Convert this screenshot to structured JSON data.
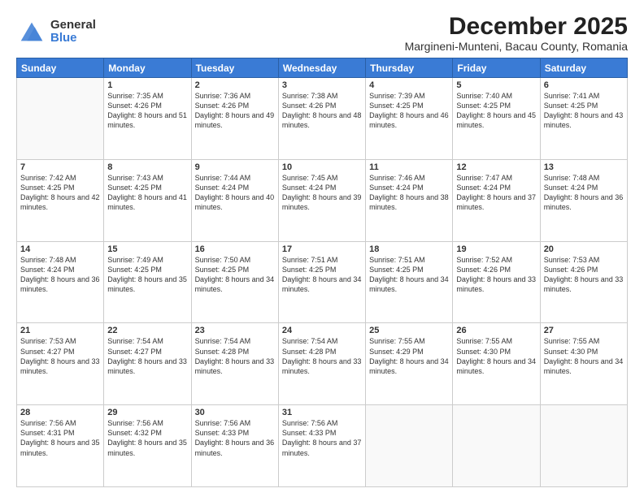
{
  "logo": {
    "general": "General",
    "blue": "Blue"
  },
  "title": "December 2025",
  "subtitle": "Margineni-Munteni, Bacau County, Romania",
  "weekdays": [
    "Sunday",
    "Monday",
    "Tuesday",
    "Wednesday",
    "Thursday",
    "Friday",
    "Saturday"
  ],
  "weeks": [
    [
      {
        "day": "",
        "sunrise": "",
        "sunset": "",
        "daylight": ""
      },
      {
        "day": "1",
        "sunrise": "Sunrise: 7:35 AM",
        "sunset": "Sunset: 4:26 PM",
        "daylight": "Daylight: 8 hours and 51 minutes."
      },
      {
        "day": "2",
        "sunrise": "Sunrise: 7:36 AM",
        "sunset": "Sunset: 4:26 PM",
        "daylight": "Daylight: 8 hours and 49 minutes."
      },
      {
        "day": "3",
        "sunrise": "Sunrise: 7:38 AM",
        "sunset": "Sunset: 4:26 PM",
        "daylight": "Daylight: 8 hours and 48 minutes."
      },
      {
        "day": "4",
        "sunrise": "Sunrise: 7:39 AM",
        "sunset": "Sunset: 4:25 PM",
        "daylight": "Daylight: 8 hours and 46 minutes."
      },
      {
        "day": "5",
        "sunrise": "Sunrise: 7:40 AM",
        "sunset": "Sunset: 4:25 PM",
        "daylight": "Daylight: 8 hours and 45 minutes."
      },
      {
        "day": "6",
        "sunrise": "Sunrise: 7:41 AM",
        "sunset": "Sunset: 4:25 PM",
        "daylight": "Daylight: 8 hours and 43 minutes."
      }
    ],
    [
      {
        "day": "7",
        "sunrise": "Sunrise: 7:42 AM",
        "sunset": "Sunset: 4:25 PM",
        "daylight": "Daylight: 8 hours and 42 minutes."
      },
      {
        "day": "8",
        "sunrise": "Sunrise: 7:43 AM",
        "sunset": "Sunset: 4:25 PM",
        "daylight": "Daylight: 8 hours and 41 minutes."
      },
      {
        "day": "9",
        "sunrise": "Sunrise: 7:44 AM",
        "sunset": "Sunset: 4:24 PM",
        "daylight": "Daylight: 8 hours and 40 minutes."
      },
      {
        "day": "10",
        "sunrise": "Sunrise: 7:45 AM",
        "sunset": "Sunset: 4:24 PM",
        "daylight": "Daylight: 8 hours and 39 minutes."
      },
      {
        "day": "11",
        "sunrise": "Sunrise: 7:46 AM",
        "sunset": "Sunset: 4:24 PM",
        "daylight": "Daylight: 8 hours and 38 minutes."
      },
      {
        "day": "12",
        "sunrise": "Sunrise: 7:47 AM",
        "sunset": "Sunset: 4:24 PM",
        "daylight": "Daylight: 8 hours and 37 minutes."
      },
      {
        "day": "13",
        "sunrise": "Sunrise: 7:48 AM",
        "sunset": "Sunset: 4:24 PM",
        "daylight": "Daylight: 8 hours and 36 minutes."
      }
    ],
    [
      {
        "day": "14",
        "sunrise": "Sunrise: 7:48 AM",
        "sunset": "Sunset: 4:24 PM",
        "daylight": "Daylight: 8 hours and 36 minutes."
      },
      {
        "day": "15",
        "sunrise": "Sunrise: 7:49 AM",
        "sunset": "Sunset: 4:25 PM",
        "daylight": "Daylight: 8 hours and 35 minutes."
      },
      {
        "day": "16",
        "sunrise": "Sunrise: 7:50 AM",
        "sunset": "Sunset: 4:25 PM",
        "daylight": "Daylight: 8 hours and 34 minutes."
      },
      {
        "day": "17",
        "sunrise": "Sunrise: 7:51 AM",
        "sunset": "Sunset: 4:25 PM",
        "daylight": "Daylight: 8 hours and 34 minutes."
      },
      {
        "day": "18",
        "sunrise": "Sunrise: 7:51 AM",
        "sunset": "Sunset: 4:25 PM",
        "daylight": "Daylight: 8 hours and 34 minutes."
      },
      {
        "day": "19",
        "sunrise": "Sunrise: 7:52 AM",
        "sunset": "Sunset: 4:26 PM",
        "daylight": "Daylight: 8 hours and 33 minutes."
      },
      {
        "day": "20",
        "sunrise": "Sunrise: 7:53 AM",
        "sunset": "Sunset: 4:26 PM",
        "daylight": "Daylight: 8 hours and 33 minutes."
      }
    ],
    [
      {
        "day": "21",
        "sunrise": "Sunrise: 7:53 AM",
        "sunset": "Sunset: 4:27 PM",
        "daylight": "Daylight: 8 hours and 33 minutes."
      },
      {
        "day": "22",
        "sunrise": "Sunrise: 7:54 AM",
        "sunset": "Sunset: 4:27 PM",
        "daylight": "Daylight: 8 hours and 33 minutes."
      },
      {
        "day": "23",
        "sunrise": "Sunrise: 7:54 AM",
        "sunset": "Sunset: 4:28 PM",
        "daylight": "Daylight: 8 hours and 33 minutes."
      },
      {
        "day": "24",
        "sunrise": "Sunrise: 7:54 AM",
        "sunset": "Sunset: 4:28 PM",
        "daylight": "Daylight: 8 hours and 33 minutes."
      },
      {
        "day": "25",
        "sunrise": "Sunrise: 7:55 AM",
        "sunset": "Sunset: 4:29 PM",
        "daylight": "Daylight: 8 hours and 34 minutes."
      },
      {
        "day": "26",
        "sunrise": "Sunrise: 7:55 AM",
        "sunset": "Sunset: 4:30 PM",
        "daylight": "Daylight: 8 hours and 34 minutes."
      },
      {
        "day": "27",
        "sunrise": "Sunrise: 7:55 AM",
        "sunset": "Sunset: 4:30 PM",
        "daylight": "Daylight: 8 hours and 34 minutes."
      }
    ],
    [
      {
        "day": "28",
        "sunrise": "Sunrise: 7:56 AM",
        "sunset": "Sunset: 4:31 PM",
        "daylight": "Daylight: 8 hours and 35 minutes."
      },
      {
        "day": "29",
        "sunrise": "Sunrise: 7:56 AM",
        "sunset": "Sunset: 4:32 PM",
        "daylight": "Daylight: 8 hours and 35 minutes."
      },
      {
        "day": "30",
        "sunrise": "Sunrise: 7:56 AM",
        "sunset": "Sunset: 4:33 PM",
        "daylight": "Daylight: 8 hours and 36 minutes."
      },
      {
        "day": "31",
        "sunrise": "Sunrise: 7:56 AM",
        "sunset": "Sunset: 4:33 PM",
        "daylight": "Daylight: 8 hours and 37 minutes."
      },
      {
        "day": "",
        "sunrise": "",
        "sunset": "",
        "daylight": ""
      },
      {
        "day": "",
        "sunrise": "",
        "sunset": "",
        "daylight": ""
      },
      {
        "day": "",
        "sunrise": "",
        "sunset": "",
        "daylight": ""
      }
    ]
  ]
}
